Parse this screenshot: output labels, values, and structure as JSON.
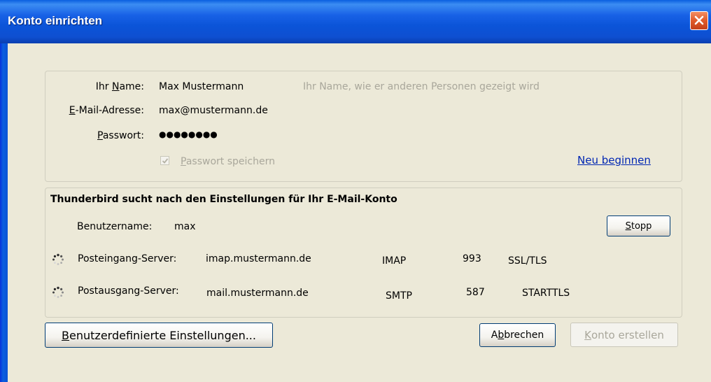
{
  "window": {
    "title": "Konto einrichten",
    "close_icon": "close-icon"
  },
  "form": {
    "name_label_pre": "Ihr ",
    "name_label_ul": "N",
    "name_label_post": "ame:",
    "name_value": "Max Mustermann",
    "name_hint": "Ihr Name, wie er anderen Personen gezeigt wird",
    "email_label_ul": "E",
    "email_label_post": "-Mail-Adresse:",
    "email_value": "max@mustermann.de",
    "password_label_ul": "P",
    "password_label_post": "asswort:",
    "password_mask": "●●●●●●●●",
    "save_password_ul": "P",
    "save_password_post": "asswort speichern",
    "save_password_checked": true,
    "restart_link": "Neu beginnen"
  },
  "settings": {
    "heading": "Thunderbird sucht nach den Einstellungen für Ihr E-Mail-Konto",
    "username_label": "Benutzername:",
    "username_value": "max",
    "stop_button_ul": "S",
    "stop_button_post": "topp",
    "incoming": {
      "label": "Posteingang-Server:",
      "host": "imap.mustermann.de",
      "protocol": "IMAP",
      "port": "993",
      "security": "SSL/TLS",
      "icon": "spinner-icon"
    },
    "outgoing": {
      "label": "Postausgang-Server:",
      "host": "mail.mustermann.de",
      "protocol": "SMTP",
      "port": "587",
      "security": "STARTTLS",
      "icon": "spinner-icon"
    }
  },
  "buttons": {
    "custom_settings_ul": "B",
    "custom_settings_post": "enutzerdefinierte Einstellungen...",
    "cancel_pre": "A",
    "cancel_ul": "b",
    "cancel_post": "brechen",
    "create_ul": "K",
    "create_post": "onto erstellen"
  }
}
